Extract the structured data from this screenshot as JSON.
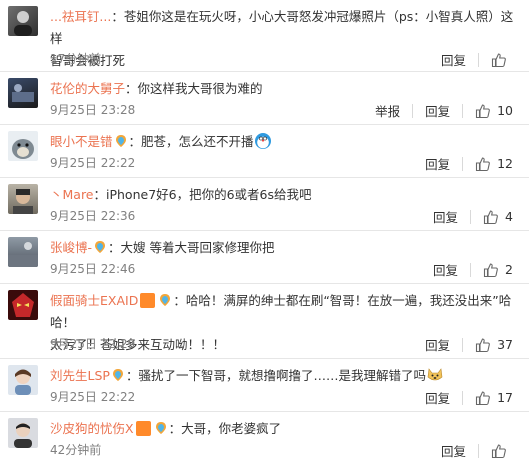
{
  "comments": [
    {
      "user": "...祛耳钉...",
      "text1": "：苍姐你这是在玩火呀，小心大哥怒发冲冠爆照片（ps：小智真人照）这样",
      "text2": "智哥会被打死",
      "time": "17分钟前",
      "reply": "回复",
      "likes": ""
    },
    {
      "user": "花伦的大舅子",
      "text1": "：你这样我大哥很为难的",
      "time": "9月25日 23:28",
      "report": "举报",
      "reply": "回复",
      "likes": "10"
    },
    {
      "user": "眼小不是错",
      "text1": "：肥苍，怎么还不开播",
      "time": "9月25日 22:22",
      "reply": "回复",
      "likes": "12"
    },
    {
      "user": "丶Mare",
      "text1": "：iPhone7好6，把你的6或者6s给我吧",
      "time": "9月25日 22:36",
      "reply": "回复",
      "likes": "4"
    },
    {
      "user": "张峻博-",
      "text1": "：大嫂  等着大哥回家修理你把",
      "time": "9月25日 22:46",
      "reply": "回复",
      "likes": "2"
    },
    {
      "user": "假面骑士EXAID",
      "text1": "：哈哈！满屏的绅士都在刷“智哥！在放一遍，我还没出来”哈哈！",
      "text2": "太污了！苍姐多来互动呦！！！",
      "time": "9月25日 22:29",
      "reply": "回复",
      "likes": "37"
    },
    {
      "user": "刘先生LSP",
      "text1": "：骚扰了一下智哥，就想撸啊撸了……是我理解错了吗",
      "time": "9月25日 22:22",
      "reply": "回复",
      "likes": "17"
    },
    {
      "user": "沙皮狗的忧伤X",
      "text1": "：大哥，你老婆疯了",
      "time": "42分钟前",
      "reply": "回复",
      "likes": ""
    }
  ],
  "colors": {
    "username": "#eb7350",
    "time": "#808080",
    "divider": "#e6e6e6"
  },
  "icons": {
    "like": "thumb-up-icon",
    "rainbow": "rainbow-badge-icon"
  }
}
